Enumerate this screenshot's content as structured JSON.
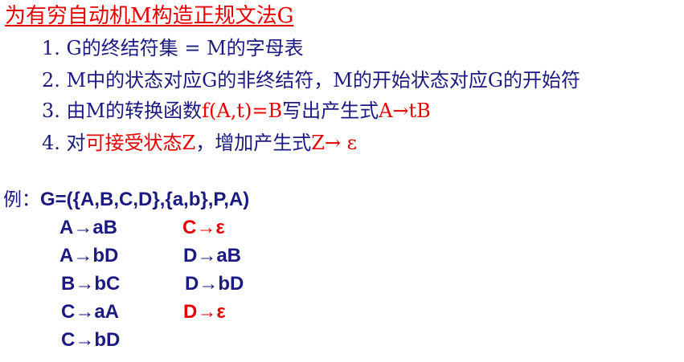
{
  "title": "为有穷自动机M构造正规文法G",
  "rules": [
    {
      "num": "1.",
      "text": "G的终结符集 = M的字母表"
    },
    {
      "num": "2.",
      "text": "M中的状态对应G的非终结符，M的开始状态对应G的开始符"
    },
    {
      "num": "3.",
      "text_a": "由M的转换函数",
      "text_red": "f(A,t)=B",
      "text_b": "写出产生式",
      "text_red2": "A→tB"
    },
    {
      "num": "4.",
      "text_a": "对",
      "text_red": "可接受状态Z",
      "text_b": "，增加产生式",
      "text_red2": "Z→ ε"
    }
  ],
  "example": {
    "label": "例：",
    "grammar": "G=({A,B,C,D},{a,b},P,A)"
  },
  "productions": {
    "left": [
      "A→aB",
      "A→bD",
      "B→bC",
      "C→aA",
      "C→bD"
    ],
    "right": [
      "C→ε",
      "D→aB",
      "D→bD",
      "D→ε"
    ]
  },
  "colors": {
    "red": "#e60000",
    "navy": "#1a1a80"
  }
}
